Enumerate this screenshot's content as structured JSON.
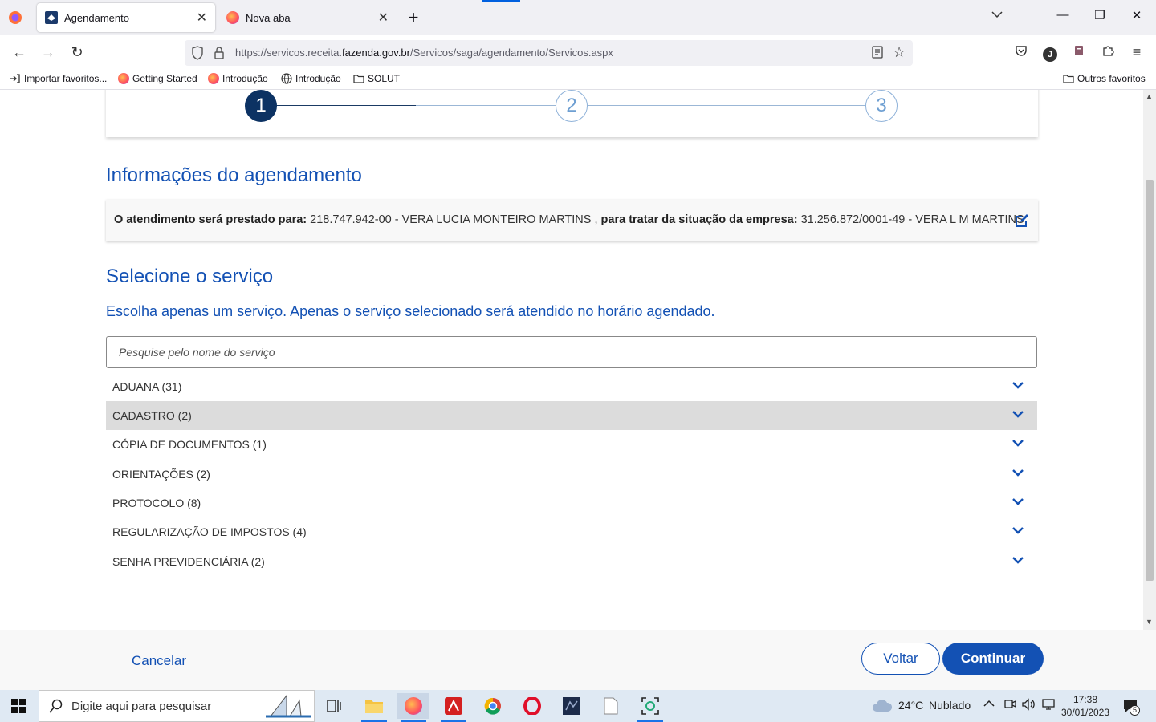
{
  "browser": {
    "tabs": [
      {
        "title": "Agendamento",
        "active": true
      },
      {
        "title": "Nova aba",
        "active": false
      }
    ],
    "new_tab": "+",
    "url_prefix": "https://servicos.receita.",
    "url_domain": "fazenda.gov.br",
    "url_suffix": "/Servicos/saga/agendamento/Servicos.aspx",
    "bookmarks": [
      "Importar favoritos...",
      "Getting Started",
      "Introdução",
      "Introdução",
      "SOLUT"
    ],
    "other_bookmarks": "Outros favoritos",
    "profile_initial": "J"
  },
  "stepper": {
    "steps": [
      "1",
      "2",
      "3"
    ],
    "current": 1
  },
  "info": {
    "heading": "Informações do agendamento",
    "label_person": "O atendimento será prestado para:",
    "person": "218.747.942-00 - VERA LUCIA MONTEIRO MARTINS",
    "label_company": "para tratar da situação da empresa:",
    "company": "31.256.872/0001-49 - VERA L M MARTINS"
  },
  "service": {
    "heading": "Selecione o serviço",
    "instruction": "Escolha apenas um serviço. Apenas o serviço selecionado será atendido no horário agendado.",
    "search_placeholder": "Pesquise pelo nome do serviço",
    "categories": [
      "ADUANA (31)",
      "CADASTRO (2)",
      "CÓPIA DE DOCUMENTOS (1)",
      "ORIENTAÇÕES (2)",
      "PROTOCOLO (8)",
      "REGULARIZAÇÃO DE IMPOSTOS (4)",
      "SENHA PREVIDENCIÁRIA (2)"
    ],
    "highlighted_index": 1
  },
  "actions": {
    "cancel": "Cancelar",
    "back": "Voltar",
    "continue": "Continuar"
  },
  "taskbar": {
    "search_placeholder": "Digite aqui para pesquisar",
    "weather_temp": "24°C",
    "weather_desc": "Nublado",
    "time": "17:38",
    "date": "30/01/2023",
    "notifications": "5"
  },
  "colors": {
    "primary": "#1351b4",
    "step_current": "#0c3263"
  }
}
